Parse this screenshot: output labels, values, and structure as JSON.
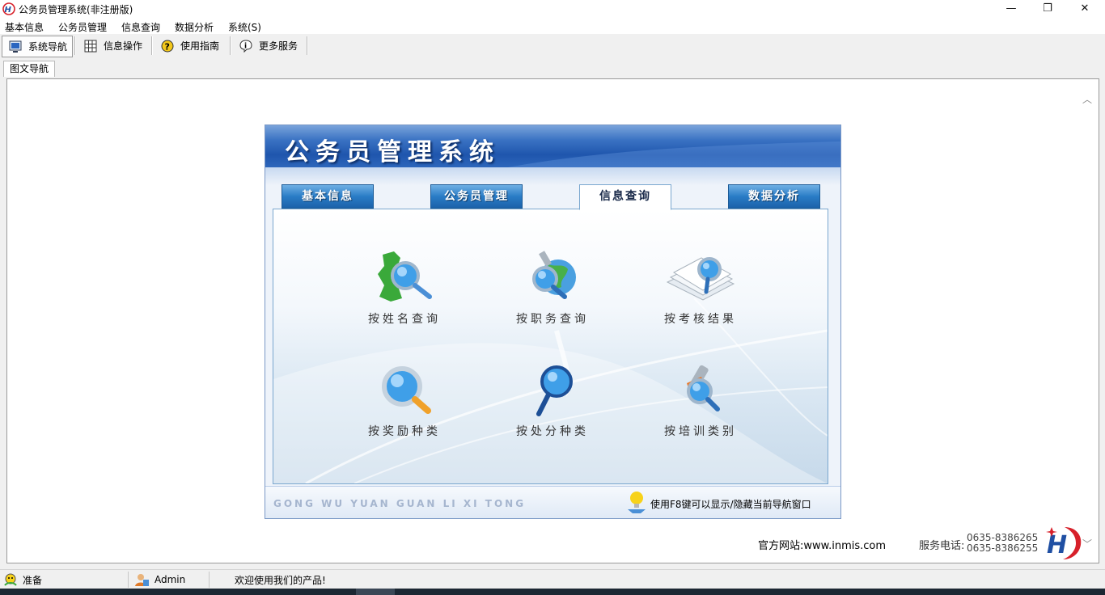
{
  "window": {
    "title": "公务员管理系统(非注册版)",
    "controls": {
      "minimize": "—",
      "maximize": "❐",
      "close": "✕"
    }
  },
  "menu": [
    "基本信息",
    "公务员管理",
    "信息查询",
    "数据分析",
    "系统(S)"
  ],
  "toolbar": [
    {
      "label": "系统导航",
      "icon": "monitor-icon"
    },
    {
      "label": "信息操作",
      "icon": "grid-icon"
    },
    {
      "label": "使用指南",
      "icon": "help-icon"
    },
    {
      "label": "更多服务",
      "icon": "info-icon"
    }
  ],
  "doc_tab": "图文导航",
  "panel": {
    "title": "公务员管理系统",
    "tabs": [
      "基本信息",
      "公务员管理",
      "信息查询",
      "数据分析"
    ],
    "active_tab": "信息查询",
    "items": [
      {
        "label": "按姓名查询",
        "icon": "map-magnifier-icon"
      },
      {
        "label": "按职务查询",
        "icon": "globe-magnifier-icon"
      },
      {
        "label": "按考核结果",
        "icon": "documents-magnifier-icon"
      },
      {
        "label": "按奖励种类",
        "icon": "magnifier-icon"
      },
      {
        "label": "按处分种类",
        "icon": "magnifier-handle-icon"
      },
      {
        "label": "按培训类别",
        "icon": "tools-magnifier-icon"
      }
    ],
    "footer_pinyin": "GONG WU YUAN GUAN LI XI TONG",
    "footer_hint": "使用F8键可以显示/隐藏当前导航窗口"
  },
  "footer_info": {
    "website": "官方网站:www.inmis.com",
    "phone_label": "服务电话:",
    "phone1": "0635-8386265",
    "phone2": "0635-8386255"
  },
  "status": {
    "state": "准备",
    "user": "Admin",
    "message": "欢迎使用我们的产品!"
  },
  "colors": {
    "panel_header": "#1f56ad",
    "tab_blue": "#2a7cc6",
    "logo_red": "#d7202a",
    "logo_blue": "#1f4fa3"
  }
}
